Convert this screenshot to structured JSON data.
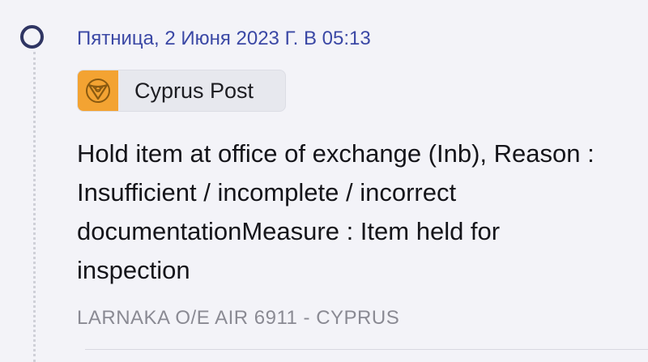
{
  "event": {
    "date": "Пятница, 2 Июня 2023 Г. В 05:13",
    "carrier": {
      "name": "Cyprus Post",
      "logo_icon": "post-horn-icon"
    },
    "description": "Hold item at office of exchange (Inb), Reason : Insufficient / incomplete / incorrect documentationMeasure : Item held for inspection",
    "location": "LARNAKA O/E AIR 6911 - CYPRUS"
  },
  "colors": {
    "accent": "#3b48a5",
    "timeline_dot": "#2f3563",
    "logo_background": "#f3a332",
    "background": "#f3f3f8",
    "location_text": "#8a8a93"
  }
}
